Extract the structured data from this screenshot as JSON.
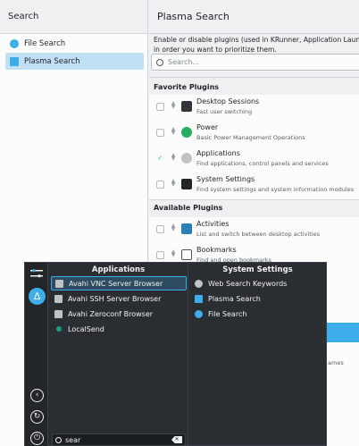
{
  "left_pane": {
    "title": "Search",
    "items": [
      {
        "label": "File Search",
        "icon": "file-search-icon",
        "selected": false
      },
      {
        "label": "Plasma Search",
        "icon": "plasma-search-icon",
        "selected": true
      }
    ]
  },
  "right_pane": {
    "title": "Plasma Search",
    "description_line1": "Enable or disable plugins (used in KRunner, Application Launche",
    "description_line2": "in order you want to prioritize them.",
    "search_placeholder": "Search...",
    "favorite_title": "Favorite Plugins",
    "favorites": [
      {
        "name": "Desktop Sessions",
        "desc": "Fast user switching",
        "checked": false,
        "icon": "desktop-sessions-icon"
      },
      {
        "name": "Power",
        "desc": "Basic Power Management Operations",
        "checked": false,
        "icon": "power-icon"
      },
      {
        "name": "Applications",
        "desc": "Find applications, control panels and services",
        "checked": true,
        "icon": "applications-icon"
      },
      {
        "name": "System Settings",
        "desc": "Find system settings and system information modules",
        "checked": false,
        "icon": "system-settings-icon"
      }
    ],
    "available_title": "Available Plugins",
    "available": [
      {
        "name": "Activities",
        "desc": "List and switch between desktop activities",
        "checked": false,
        "icon": "activities-icon"
      },
      {
        "name": "Bookmarks",
        "desc": "Find and open bookmarks",
        "checked": false,
        "icon": "bookmarks-icon"
      }
    ],
    "partial_text": "ames"
  },
  "launcher": {
    "applications_title": "Applications",
    "system_settings_title": "System Settings",
    "applications": [
      {
        "label": "Avahi VNC Server Browser",
        "selected": true
      },
      {
        "label": "Avahi SSH Server Browser",
        "selected": false
      },
      {
        "label": "Avahi Zeroconf Browser",
        "selected": false
      },
      {
        "label": "LocalSend",
        "selected": false
      }
    ],
    "system_settings": [
      {
        "label": "Web Search Keywords",
        "icon": "web-search-icon"
      },
      {
        "label": "Plasma Search",
        "icon": "plasma-search-icon"
      },
      {
        "label": "File Search",
        "icon": "file-search-icon"
      }
    ],
    "search_value": "sear"
  },
  "colors": {
    "accent": "#3daee9",
    "launcher_bg": "#2a2e32",
    "window_bg": "#eff0f1"
  }
}
